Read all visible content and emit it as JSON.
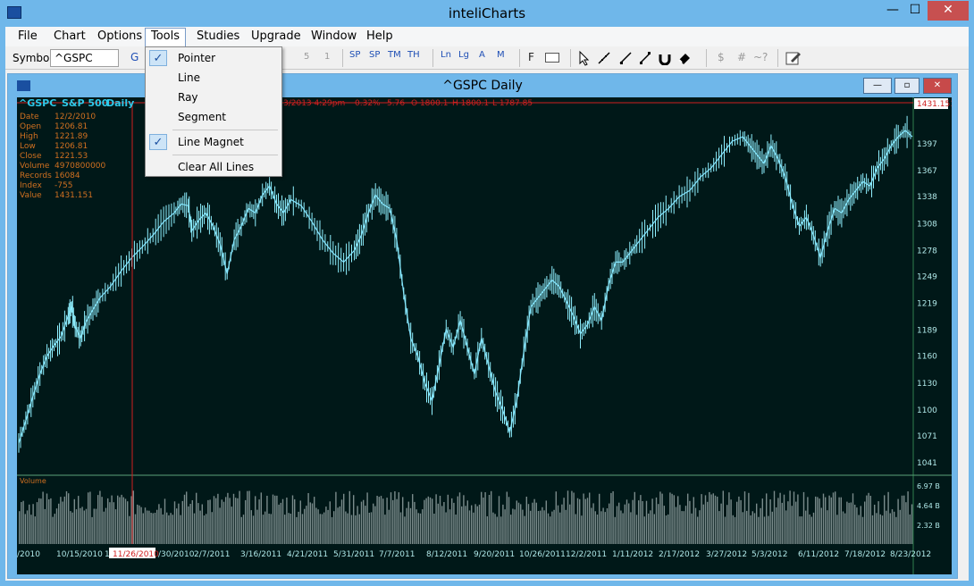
{
  "window": {
    "title": "inteliCharts",
    "min": "—",
    "max": "☐",
    "close": "✕"
  },
  "menu": {
    "file": "File",
    "chart": "Chart",
    "options": "Options",
    "tools": "Tools",
    "studies": "Studies",
    "upgrade": "Upgrade",
    "window": "Window",
    "help": "Help"
  },
  "toolbar": {
    "symbol_label": "Symbol",
    "symbol_value": "^GSPC",
    "g": "G",
    "n5": "5",
    "n1": "1",
    "sp1": "SP",
    "sp2": "SP",
    "tm1": "TM",
    "tm2": "TH",
    "ln": "Ln",
    "lg": "Lg",
    "a": "A",
    "m": "M",
    "f": "F",
    "dollar": "$",
    "hash": "#",
    "wave": "~?"
  },
  "tools_menu": {
    "pointer": "Pointer",
    "line": "Line",
    "ray": "Ray",
    "segment": "Segment",
    "line_magnet": "Line Magnet",
    "clear_all": "Clear All Lines"
  },
  "chart_window": {
    "title": "^GSPC Daily",
    "min": "—",
    "max": "▫",
    "close": "✕"
  },
  "chart_header": {
    "symbol": "^GSPC",
    "name": "S&P 500",
    "period": "Daily",
    "datetime": "3/2013  4:29pm",
    "pct": "0.32%",
    "chg": "5.76",
    "o": "O 1800.1",
    "h": "H 1800.1",
    "l": "L 1787.85"
  },
  "info": {
    "labels": [
      "Date",
      "Open",
      "High",
      "Low",
      "Close",
      "Volume",
      "Records",
      "Index",
      "Value"
    ],
    "values": [
      "12/2/2010",
      "1206.81",
      "1221.89",
      "1206.81",
      "1221.53",
      "4970800000",
      "16084",
      "-755",
      "1431.151"
    ]
  },
  "volume_label": "Volume",
  "cursor_label": "1431.151",
  "cursor_date": "11/26/2010",
  "chart_data": {
    "type": "line",
    "price_ticks": [
      "1397",
      "1367",
      "1338",
      "1308",
      "1278",
      "1249",
      "1219",
      "1189",
      "1160",
      "1130",
      "1100",
      "1071",
      "1041"
    ],
    "price_tick_values": [
      1397,
      1367,
      1338,
      1308,
      1278,
      1249,
      1219,
      1189,
      1160,
      1130,
      1100,
      1071,
      1041
    ],
    "volume_ticks": [
      "6.97 B",
      "4.64 B",
      "2.32 B"
    ],
    "date_ticks": [
      "/2010",
      "10/15/2010",
      "11",
      "/30/2010",
      "2/7/2011",
      "3/16/2011",
      "4/21/2011",
      "5/31/2011",
      "7/7/2011",
      "8/12/2011",
      "9/20/2011",
      "10/26/2011",
      "12/2/2011",
      "1/11/2012",
      "2/17/2012",
      "3/27/2012",
      "5/3/2012",
      "6/11/2012",
      "7/18/2012",
      "8/23/2012"
    ],
    "ylim": [
      1030,
      1435
    ],
    "close_path": [
      [
        0,
        1063
      ],
      [
        4,
        1088
      ],
      [
        8,
        1115
      ],
      [
        12,
        1140
      ],
      [
        16,
        1160
      ],
      [
        20,
        1172
      ],
      [
        24,
        1182
      ],
      [
        28,
        1205
      ],
      [
        30,
        1215
      ],
      [
        32,
        1193
      ],
      [
        35,
        1180
      ],
      [
        38,
        1198
      ],
      [
        42,
        1212
      ],
      [
        46,
        1225
      ],
      [
        52,
        1238
      ],
      [
        58,
        1255
      ],
      [
        64,
        1270
      ],
      [
        70,
        1282
      ],
      [
        76,
        1295
      ],
      [
        82,
        1310
      ],
      [
        88,
        1320
      ],
      [
        92,
        1330
      ],
      [
        96,
        1328
      ],
      [
        98,
        1300
      ],
      [
        102,
        1312
      ],
      [
        106,
        1320
      ],
      [
        110,
        1305
      ],
      [
        114,
        1285
      ],
      [
        118,
        1252
      ],
      [
        122,
        1290
      ],
      [
        126,
        1305
      ],
      [
        130,
        1325
      ],
      [
        134,
        1320
      ],
      [
        138,
        1340
      ],
      [
        142,
        1350
      ],
      [
        146,
        1330
      ],
      [
        150,
        1320
      ],
      [
        154,
        1335
      ],
      [
        160,
        1328
      ],
      [
        166,
        1310
      ],
      [
        172,
        1290
      ],
      [
        178,
        1275
      ],
      [
        184,
        1265
      ],
      [
        190,
        1278
      ],
      [
        194,
        1295
      ],
      [
        198,
        1320
      ],
      [
        202,
        1340
      ],
      [
        206,
        1330
      ],
      [
        210,
        1325
      ],
      [
        214,
        1290
      ],
      [
        218,
        1230
      ],
      [
        222,
        1180
      ],
      [
        226,
        1160
      ],
      [
        230,
        1130
      ],
      [
        234,
        1110
      ],
      [
        238,
        1150
      ],
      [
        242,
        1190
      ],
      [
        246,
        1170
      ],
      [
        250,
        1200
      ],
      [
        254,
        1170
      ],
      [
        258,
        1140
      ],
      [
        262,
        1180
      ],
      [
        266,
        1150
      ],
      [
        270,
        1120
      ],
      [
        274,
        1100
      ],
      [
        278,
        1075
      ],
      [
        282,
        1110
      ],
      [
        286,
        1165
      ],
      [
        290,
        1215
      ],
      [
        294,
        1225
      ],
      [
        298,
        1235
      ],
      [
        302,
        1245
      ],
      [
        306,
        1238
      ],
      [
        310,
        1222
      ],
      [
        314,
        1205
      ],
      [
        318,
        1185
      ],
      [
        322,
        1195
      ],
      [
        326,
        1215
      ],
      [
        330,
        1200
      ],
      [
        334,
        1240
      ],
      [
        338,
        1265
      ],
      [
        342,
        1265
      ],
      [
        346,
        1275
      ],
      [
        350,
        1285
      ],
      [
        356,
        1300
      ],
      [
        362,
        1315
      ],
      [
        368,
        1325
      ],
      [
        374,
        1338
      ],
      [
        380,
        1345
      ],
      [
        386,
        1360
      ],
      [
        392,
        1370
      ],
      [
        398,
        1385
      ],
      [
        404,
        1400
      ],
      [
        410,
        1405
      ],
      [
        414,
        1395
      ],
      [
        418,
        1385
      ],
      [
        422,
        1375
      ],
      [
        426,
        1395
      ],
      [
        430,
        1380
      ],
      [
        434,
        1360
      ],
      [
        438,
        1330
      ],
      [
        442,
        1305
      ],
      [
        446,
        1315
      ],
      [
        450,
        1295
      ],
      [
        454,
        1270
      ],
      [
        458,
        1300
      ],
      [
        462,
        1325
      ],
      [
        466,
        1320
      ],
      [
        470,
        1335
      ],
      [
        474,
        1345
      ],
      [
        478,
        1355
      ],
      [
        482,
        1350
      ],
      [
        486,
        1370
      ],
      [
        490,
        1380
      ],
      [
        494,
        1395
      ],
      [
        498,
        1405
      ],
      [
        502,
        1412
      ],
      [
        506,
        1405
      ]
    ]
  }
}
